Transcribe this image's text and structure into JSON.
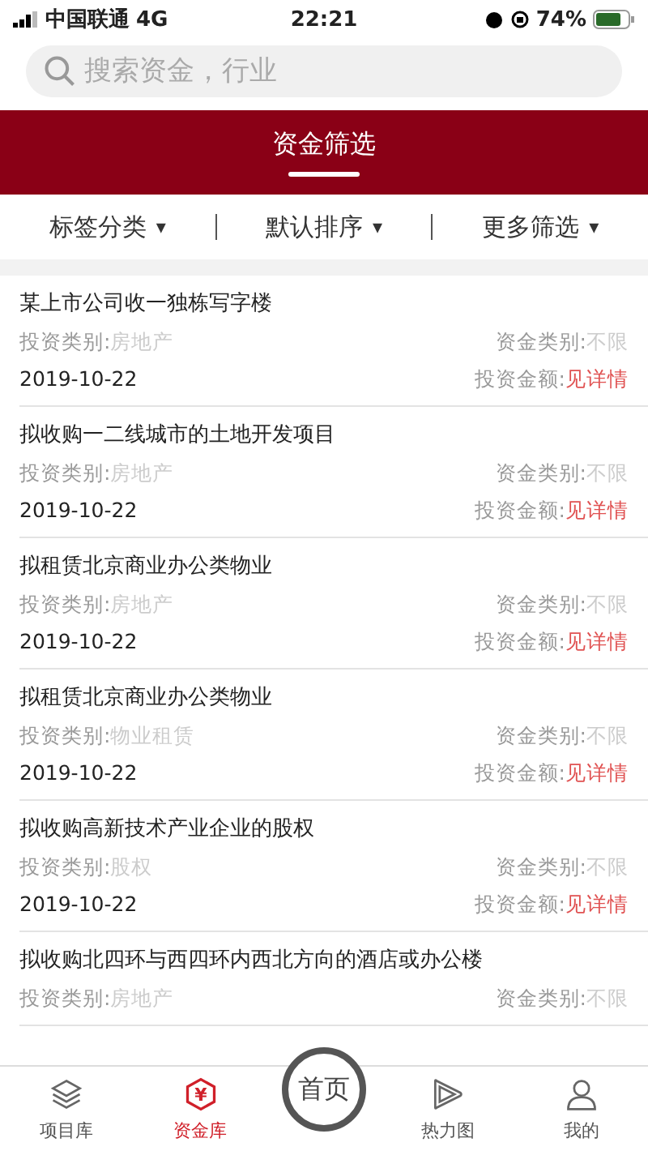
{
  "status_bar": {
    "carrier": "中国联通",
    "network": "4G",
    "time": "22:21",
    "battery": "74%"
  },
  "search": {
    "placeholder": "搜索资金，行业"
  },
  "header": {
    "title": "资金筛选"
  },
  "filters": [
    {
      "label": "标签分类",
      "caret": "▾"
    },
    {
      "label": "默认排序",
      "caret": "▾"
    },
    {
      "label": "更多筛选",
      "caret": "▾"
    }
  ],
  "listings": [
    {
      "title": "某上市公司收一独栋写字楼",
      "invest_label": "投资类别:",
      "invest_value": "房地产",
      "fund_label": "资金类别:",
      "fund_value": "不限",
      "date": "2019-10-22",
      "amount_label": "投资金额:",
      "amount_value": "见详情"
    },
    {
      "title": "拟收购一二线城市的土地开发项目",
      "invest_label": "投资类别:",
      "invest_value": "房地产",
      "fund_label": "资金类别:",
      "fund_value": "不限",
      "date": "2019-10-22",
      "amount_label": "投资金额:",
      "amount_value": "见详情"
    },
    {
      "title": "拟租赁北京商业办公类物业",
      "invest_label": "投资类别:",
      "invest_value": "房地产",
      "fund_label": "资金类别:",
      "fund_value": "不限",
      "date": "2019-10-22",
      "amount_label": "投资金额:",
      "amount_value": "见详情"
    },
    {
      "title": "拟租赁北京商业办公类物业",
      "invest_label": "投资类别:",
      "invest_value": "物业租赁",
      "fund_label": "资金类别:",
      "fund_value": "不限",
      "date": "2019-10-22",
      "amount_label": "投资金额:",
      "amount_value": "见详情"
    },
    {
      "title": "拟收购高新技术产业企业的股权",
      "invest_label": "投资类别:",
      "invest_value": "股权",
      "fund_label": "资金类别:",
      "fund_value": "不限",
      "date": "2019-10-22",
      "amount_label": "投资金额:",
      "amount_value": "见详情"
    },
    {
      "title": "拟收购北四环与西四环内西北方向的酒店或办公楼",
      "invest_label": "投资类别:",
      "invest_value": "房地产",
      "fund_label": "资金类别:",
      "fund_value": "不限"
    }
  ],
  "tab_bar": [
    {
      "kind": "layers",
      "label": "项目库",
      "selected": false
    },
    {
      "kind": "yen",
      "label": "资金库",
      "glyph": "¥",
      "selected": true
    },
    {
      "kind": "center",
      "label": "首页",
      "selected": false
    },
    {
      "kind": "play",
      "label": "热力图",
      "selected": false
    },
    {
      "kind": "person",
      "label": "我的",
      "selected": false
    }
  ]
}
